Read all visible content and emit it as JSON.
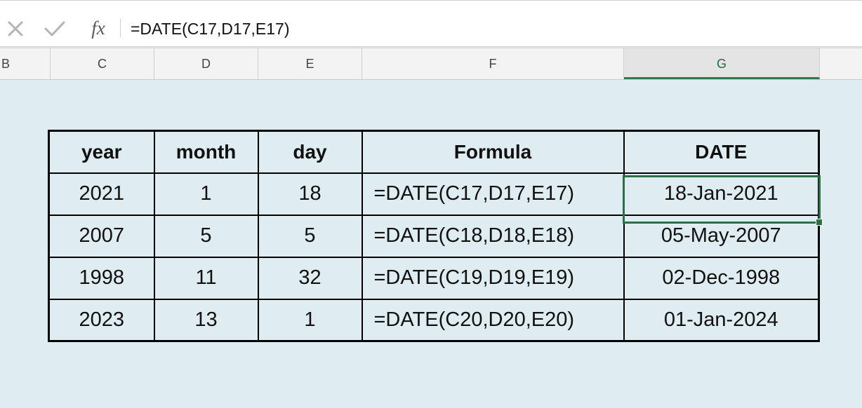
{
  "formula_bar": {
    "cancel_icon": "close-x-icon",
    "enter_icon": "checkmark-icon",
    "fx_label": "fx",
    "formula": "=DATE(C17,D17,E17)"
  },
  "column_headers": [
    "B",
    "C",
    "D",
    "E",
    "F",
    "G"
  ],
  "selected_column": "G",
  "table": {
    "headers": [
      "year",
      "month",
      "day",
      "Formula",
      "DATE"
    ],
    "rows": [
      [
        "2021",
        "1",
        "18",
        "=DATE(C17,D17,E17)",
        "18-Jan-2021"
      ],
      [
        "2007",
        "5",
        "5",
        "=DATE(C18,D18,E18)",
        "05-May-2007"
      ],
      [
        "1998",
        "11",
        "32",
        "=DATE(C19,D19,E19)",
        "02-Dec-1998"
      ],
      [
        "2023",
        "13",
        "1",
        "=DATE(C20,D20,E20)",
        "01-Jan-2024"
      ]
    ]
  },
  "colors": {
    "sheet_background": "#dfecf1",
    "selection_green": "#2e6d46"
  }
}
